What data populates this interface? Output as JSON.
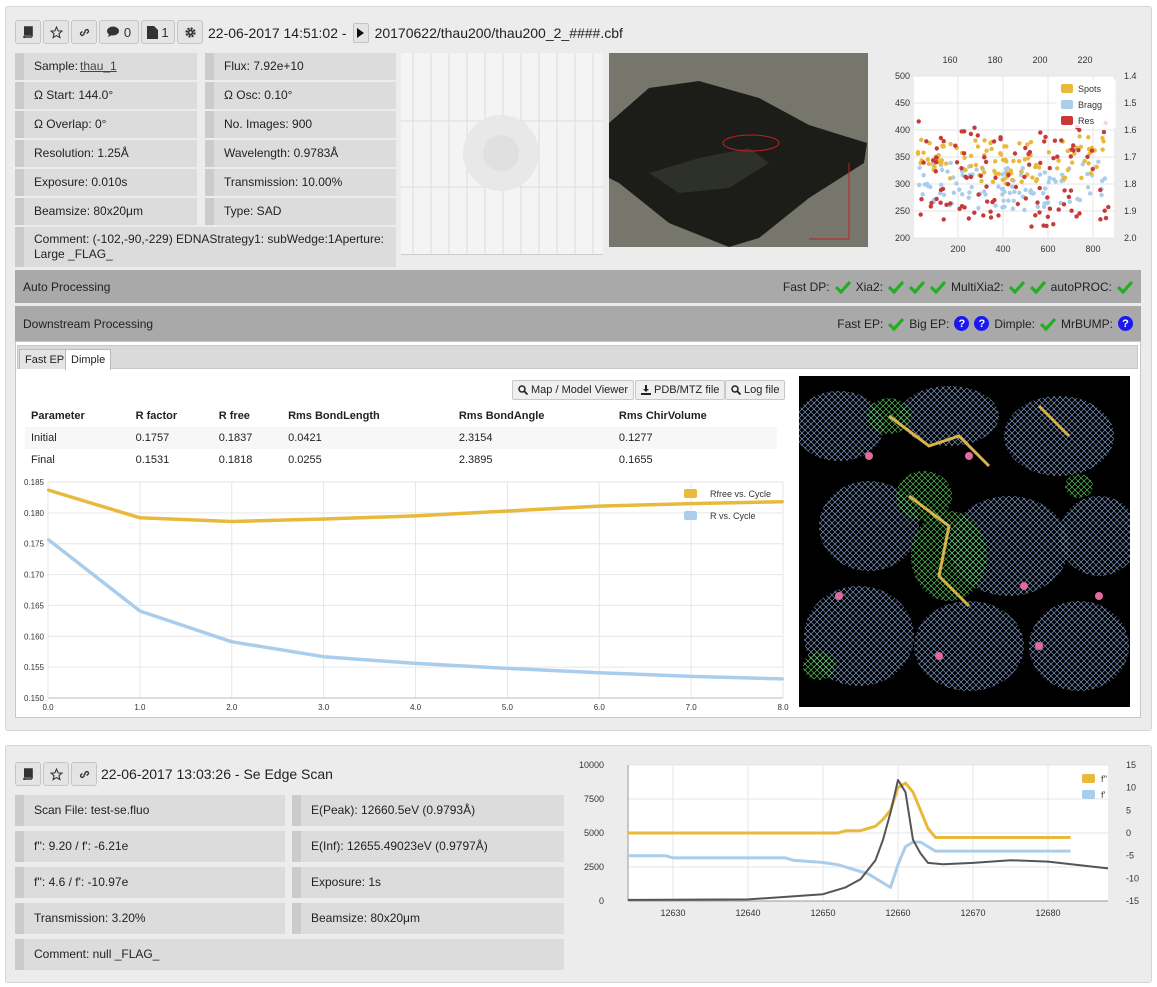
{
  "colors": {
    "gold": "#e8b93b",
    "lightblue": "#a9cdea",
    "red": "#c83a3a",
    "green": "#22b022",
    "blue": "#1a1af0"
  },
  "collection": {
    "toolbar": {
      "comment_count": "0",
      "file_count": "1"
    },
    "datetime": "22-06-2017 14:51:02 -",
    "filepath": "20170622/thau200/thau200_2_####.cbf",
    "params_left": [
      {
        "label": "Sample: ",
        "link": "thau_1"
      },
      {
        "text": "Ω Start: 144.0°"
      },
      {
        "text": "Ω Overlap: 0°"
      },
      {
        "text": "Resolution: 1.25Å"
      },
      {
        "text": "Exposure: 0.010s"
      },
      {
        "text": "Beamsize: 80x20μm"
      }
    ],
    "params_right": [
      "Flux: 7.92e+10",
      "Ω Osc: 0.10°",
      "No. Images: 900",
      "Wavelength: 0.9783Å",
      "Transmission: 10.00%",
      "Type: SAD"
    ],
    "comment": "Comment:  (-102,-90,-229) EDNAStrategy1: subWedge:1Aperture: Large _FLAG_",
    "spots_chart": {
      "type": "scatter",
      "legend": [
        "Spots",
        "Bragg",
        "Res"
      ],
      "x_ticks": [
        "200",
        "400",
        "600",
        "800"
      ],
      "x2_ticks": [
        "160",
        "180",
        "200",
        "220"
      ],
      "y_ticks": [
        "500",
        "450",
        "400",
        "350",
        "300",
        "250",
        "200"
      ],
      "y2_ticks": [
        "1.4",
        "1.5",
        "1.6",
        "1.7",
        "1.8",
        "1.9",
        "2.0"
      ]
    }
  },
  "auto_processing": {
    "label": "Auto Processing",
    "items": [
      {
        "name": "Fast DP:",
        "status": [
          "ok"
        ]
      },
      {
        "name": "Xia2:",
        "status": [
          "ok",
          "ok",
          "ok"
        ]
      },
      {
        "name": "MultiXia2:",
        "status": [
          "ok",
          "ok"
        ]
      },
      {
        "name": "autoPROC:",
        "status": [
          "ok"
        ]
      }
    ]
  },
  "downstream": {
    "label": "Downstream Processing",
    "items": [
      {
        "name": "Fast EP:",
        "status": [
          "ok"
        ]
      },
      {
        "name": "Big EP:",
        "status": [
          "q",
          "q"
        ]
      },
      {
        "name": "Dimple:",
        "status": [
          "ok"
        ]
      },
      {
        "name": "MrBUMP:",
        "status": [
          "q"
        ]
      }
    ],
    "tabs": [
      "Fast EP",
      "Dimple"
    ],
    "buttons": [
      "Map / Model Viewer",
      "PDB/MTZ file",
      "Log file"
    ],
    "table": {
      "headers": [
        "Parameter",
        "R factor",
        "R free",
        "Rms BondLength",
        "Rms BondAngle",
        "Rms ChirVolume"
      ],
      "rows": [
        [
          "Initial",
          "0.1757",
          "0.1837",
          "0.0421",
          "2.3154",
          "0.1277"
        ],
        [
          "Final",
          "0.1531",
          "0.1818",
          "0.0255",
          "2.3895",
          "0.1655"
        ]
      ]
    }
  },
  "chart_data": [
    {
      "type": "line",
      "legend_position": "top-right",
      "series": [
        {
          "name": "Rfree vs. Cycle",
          "color": "#e8b93b",
          "x": [
            0,
            1,
            2,
            3,
            4,
            5,
            6,
            7,
            8
          ],
          "y": [
            0.1837,
            0.1792,
            0.1786,
            0.179,
            0.1795,
            0.1803,
            0.1811,
            0.1815,
            0.1818
          ]
        },
        {
          "name": "R vs. Cycle",
          "color": "#a9cdea",
          "x": [
            0,
            1,
            2,
            3,
            4,
            5,
            6,
            7,
            8
          ],
          "y": [
            0.1757,
            0.1641,
            0.1591,
            0.1567,
            0.1556,
            0.1548,
            0.1541,
            0.1535,
            0.1531
          ]
        }
      ],
      "xlim": [
        0,
        8
      ],
      "ylim": [
        0.15,
        0.185
      ],
      "x_ticks": [
        "0.0",
        "1.0",
        "2.0",
        "3.0",
        "4.0",
        "5.0",
        "6.0",
        "7.0",
        "8.0"
      ],
      "y_ticks": [
        "0.185",
        "0.180",
        "0.175",
        "0.170",
        "0.165",
        "0.160",
        "0.155",
        "0.150"
      ],
      "grid": true
    },
    {
      "type": "line",
      "legend_position": "top-right",
      "series": [
        {
          "name": "f''",
          "color": "#e8b93b",
          "axis": "right",
          "x": [
            12624,
            12652,
            12653,
            12655,
            12656,
            12657,
            12658,
            12659,
            12660,
            12661,
            12662,
            12663,
            12664,
            12665,
            12683
          ],
          "y": [
            0,
            0,
            0.5,
            0.5,
            1,
            1.5,
            3,
            5,
            10,
            11,
            9,
            5,
            1,
            -1,
            -1
          ]
        },
        {
          "name": "f'",
          "color": "#a9cdea",
          "axis": "right",
          "x": [
            12624,
            12629,
            12630,
            12645,
            12646,
            12650,
            12652,
            12653,
            12654,
            12655,
            12656,
            12657,
            12658,
            12659,
            12660,
            12661,
            12662,
            12663,
            12664,
            12665,
            12666,
            12683
          ],
          "y": [
            -5,
            -5,
            -5.5,
            -5.5,
            -6,
            -6.5,
            -7,
            -7.5,
            -8,
            -8.5,
            -9,
            -10,
            -11,
            -12,
            -7,
            -3,
            -2,
            -2,
            -3,
            -4,
            -4,
            -4
          ]
        },
        {
          "name": "",
          "color": "#555555",
          "axis": "left",
          "x": [
            12624,
            12640,
            12645,
            12650,
            12653,
            12655,
            12657,
            12658,
            12659,
            12660,
            12661,
            12662,
            12663,
            12664,
            12666,
            12670,
            12675,
            12680,
            12688
          ],
          "y": [
            80,
            120,
            300,
            500,
            1000,
            1600,
            3000,
            4500,
            6500,
            8900,
            8000,
            4500,
            3500,
            2800,
            2700,
            2800,
            3000,
            2900,
            2400
          ]
        }
      ],
      "xlim": [
        12624,
        12688
      ],
      "ylim": [
        0,
        10000
      ],
      "y2lim": [
        -15,
        15
      ],
      "x_ticks": [
        "12630",
        "12640",
        "12650",
        "12660",
        "12670",
        "12680"
      ],
      "y_ticks": [
        "10000",
        "7500",
        "5000",
        "2500",
        "0"
      ],
      "y2_ticks": [
        "15",
        "10",
        "5",
        "0",
        "-5",
        "-10",
        "-15"
      ]
    }
  ],
  "edge_scan": {
    "datetime": "22-06-2017 13:03:26 - Se Edge Scan",
    "params_left": [
      "Scan File: test-se.fluo",
      "f'': 9.20 / f': -6.21e",
      "f'': 4.6 / f': -10.97e",
      "Transmission: 3.20%"
    ],
    "params_right": [
      "E(Peak): 12660.5eV (0.9793Å)",
      "E(Inf): 12655.49023eV (0.9797Å)",
      "Exposure: 1s",
      "Beamsize: 80x20μm"
    ],
    "comment": "Comment:   null _FLAG_"
  }
}
